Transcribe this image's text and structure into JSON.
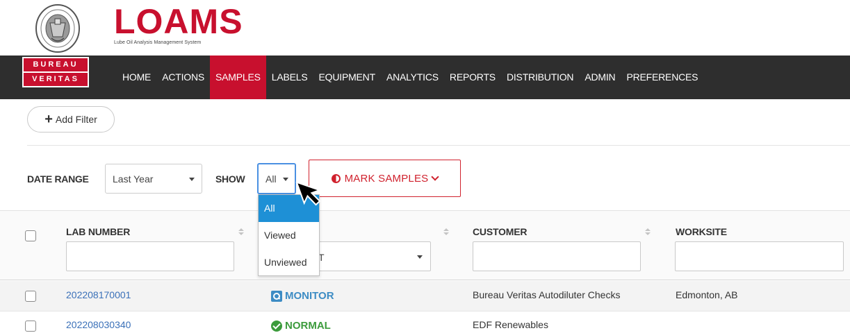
{
  "brand": {
    "logo_text": "LOAMS",
    "logo_tagline": "Lube Oil Analysis Management System",
    "badge_line1": "BUREAU",
    "badge_line2": "VERITAS"
  },
  "nav": {
    "items": [
      {
        "label": "HOME"
      },
      {
        "label": "ACTIONS"
      },
      {
        "label": "SAMPLES",
        "active": true
      },
      {
        "label": "LABELS"
      },
      {
        "label": "EQUIPMENT"
      },
      {
        "label": "ANALYTICS"
      },
      {
        "label": "REPORTS"
      },
      {
        "label": "DISTRIBUTION"
      },
      {
        "label": "ADMIN"
      },
      {
        "label": "PREFERENCES"
      }
    ]
  },
  "filters": {
    "add_filter_label": "Add Filter",
    "date_range_label": "DATE RANGE",
    "date_range_value": "Last Year",
    "show_label": "SHOW",
    "show_value": "All",
    "show_options": [
      "All",
      "Viewed",
      "Unviewed"
    ],
    "mark_samples_label": "MARK SAMPLES"
  },
  "table": {
    "columns": [
      {
        "label": "LAB NUMBER"
      },
      {
        "label": ""
      },
      {
        "label": "CUSTOMER"
      },
      {
        "label": "WORKSITE"
      }
    ],
    "status_filter_partial": "T",
    "rows": [
      {
        "lab_number": "202208170001",
        "status": "MONITOR",
        "customer": "Bureau Veritas Autodiluter Checks",
        "worksite": "Edmonton, AB"
      },
      {
        "lab_number": "202208030340",
        "status": "NORMAL",
        "customer": "EDF Renewables",
        "worksite": ""
      }
    ]
  },
  "colors": {
    "brand_red": "#c8102e",
    "nav_bg": "#2e2e2e",
    "link_blue": "#3a70b8",
    "monitor_blue": "#3d8cc4",
    "normal_green": "#3c9b3c",
    "dropdown_selected": "#1e90d6"
  }
}
